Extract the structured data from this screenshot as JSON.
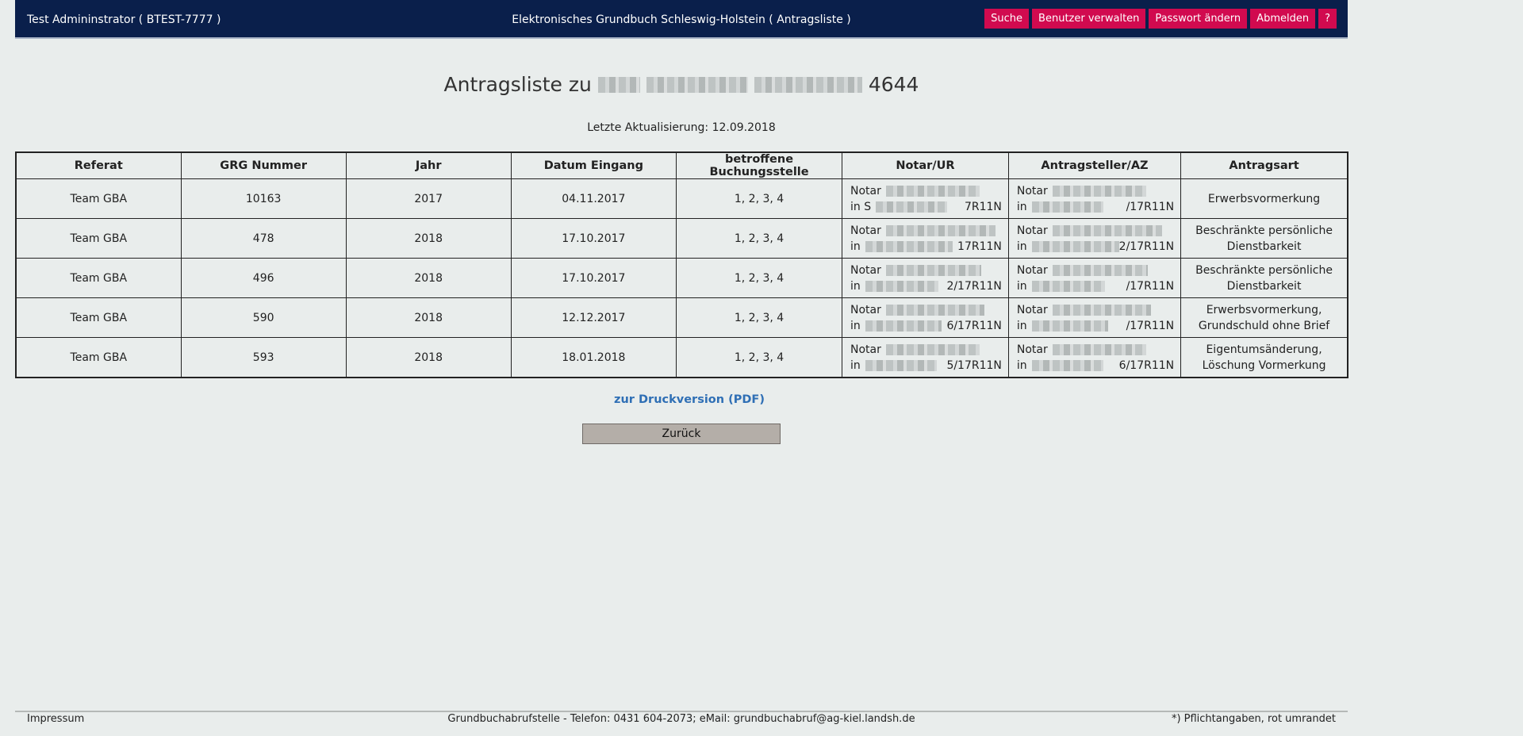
{
  "header": {
    "user": "Test Admininstrator  ( BTEST-7777 )",
    "title": "Elektronisches Grundbuch Schleswig-Holstein  ( Antragsliste )",
    "buttons": [
      "Suche",
      "Benutzer verwalten",
      "Passwort ändern",
      "Abmelden",
      "?"
    ]
  },
  "page": {
    "title_prefix": "Antragsliste zu",
    "title_suffix": "4644",
    "updated": "Letzte Aktualisierung: 12.09.2018"
  },
  "table": {
    "headers": [
      "Referat",
      "GRG Nummer",
      "Jahr",
      "Datum Eingang",
      "betroffene Buchungsstelle",
      "Notar/UR",
      "Antragsteller/AZ",
      "Antragsart"
    ],
    "rows": [
      {
        "referat": "Team GBA",
        "grg": "10163",
        "jahr": "2017",
        "datum": "04.11.2017",
        "stelle": "1, 2, 3, 4",
        "notar_l1": "Notar",
        "notar_l2_pre": "in S",
        "notar_l2_sfx": "7R11N",
        "ast_l1": "Notar",
        "ast_l2_pre": "in",
        "ast_l2_sfx": "/17R11N",
        "art": "Erwerbsvormerkung"
      },
      {
        "referat": "Team GBA",
        "grg": "478",
        "jahr": "2018",
        "datum": "17.10.2017",
        "stelle": "1, 2, 3, 4",
        "notar_l1": "Notar",
        "notar_l2_pre": "in",
        "notar_l2_sfx": "17R11N",
        "ast_l1": "Notar",
        "ast_l2_pre": "in",
        "ast_l2_sfx": "2/17R11N",
        "art": "Beschränkte persönliche Dienstbarkeit"
      },
      {
        "referat": "Team GBA",
        "grg": "496",
        "jahr": "2018",
        "datum": "17.10.2017",
        "stelle": "1, 2, 3, 4",
        "notar_l1": "Notar",
        "notar_l2_pre": "in",
        "notar_l2_sfx": "2/17R11N",
        "ast_l1": "Notar",
        "ast_l2_pre": "in",
        "ast_l2_sfx": "/17R11N",
        "art": "Beschränkte persönliche Dienstbarkeit"
      },
      {
        "referat": "Team GBA",
        "grg": "590",
        "jahr": "2018",
        "datum": "12.12.2017",
        "stelle": "1, 2, 3, 4",
        "notar_l1": "Notar",
        "notar_l2_pre": "in",
        "notar_l2_sfx": "6/17R11N",
        "ast_l1": "Notar",
        "ast_l2_pre": "in",
        "ast_l2_sfx": "/17R11N",
        "art": "Erwerbsvormerkung, Grundschuld ohne Brief"
      },
      {
        "referat": "Team GBA",
        "grg": "593",
        "jahr": "2018",
        "datum": "18.01.2018",
        "stelle": "1, 2, 3, 4",
        "notar_l1": "Notar",
        "notar_l2_pre": "in",
        "notar_l2_sfx": "5/17R11N",
        "ast_l1": "Notar",
        "ast_l2_pre": "in",
        "ast_l2_sfx": "6/17R11N",
        "art": "Eigentumsänderung, Löschung Vormerkung"
      }
    ]
  },
  "actions": {
    "print_link": "zur Druckversion (PDF)",
    "back_label": "Zurück"
  },
  "footer": {
    "impressum": "Impressum",
    "contact": "Grundbuchabrufstelle - Telefon: 0431 604-2073; eMail: grundbuchabruf@ag-kiel.landsh.de",
    "note": "*) Pflichtangaben, rot umrandet"
  },
  "colors": {
    "header_bg": "#0a1f4b",
    "button_bg": "#d10a4f",
    "link": "#2f6fb5",
    "page_bg": "#e9edec"
  }
}
